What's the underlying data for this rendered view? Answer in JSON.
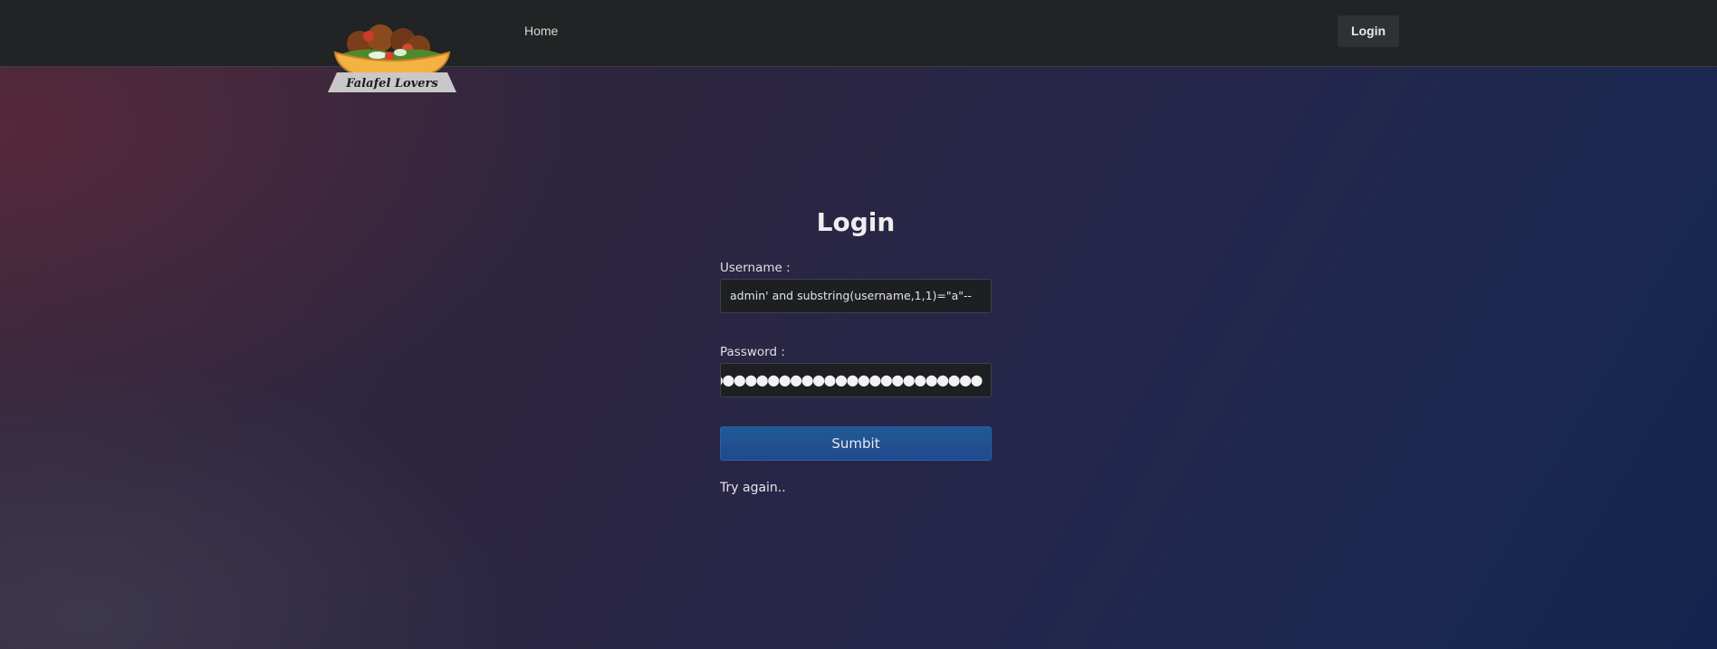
{
  "navbar": {
    "logo_text": "Falafel Lovers",
    "home_label": "Home",
    "login_label": "Login"
  },
  "login_form": {
    "title": "Login",
    "username_label": "Username :",
    "username_value": "admin' and substring(username,1,1)=\"a\"--",
    "password_label": "Password :",
    "password_value_masked": "●●●●●●●●●●●●●●●●●●●●●●●●●",
    "submit_label": "Sumbit",
    "status_message": "Try again.."
  },
  "colors": {
    "navbar_bg": "#212324",
    "submit_bg": "#21498f",
    "field_bg": "#1d1f22"
  }
}
